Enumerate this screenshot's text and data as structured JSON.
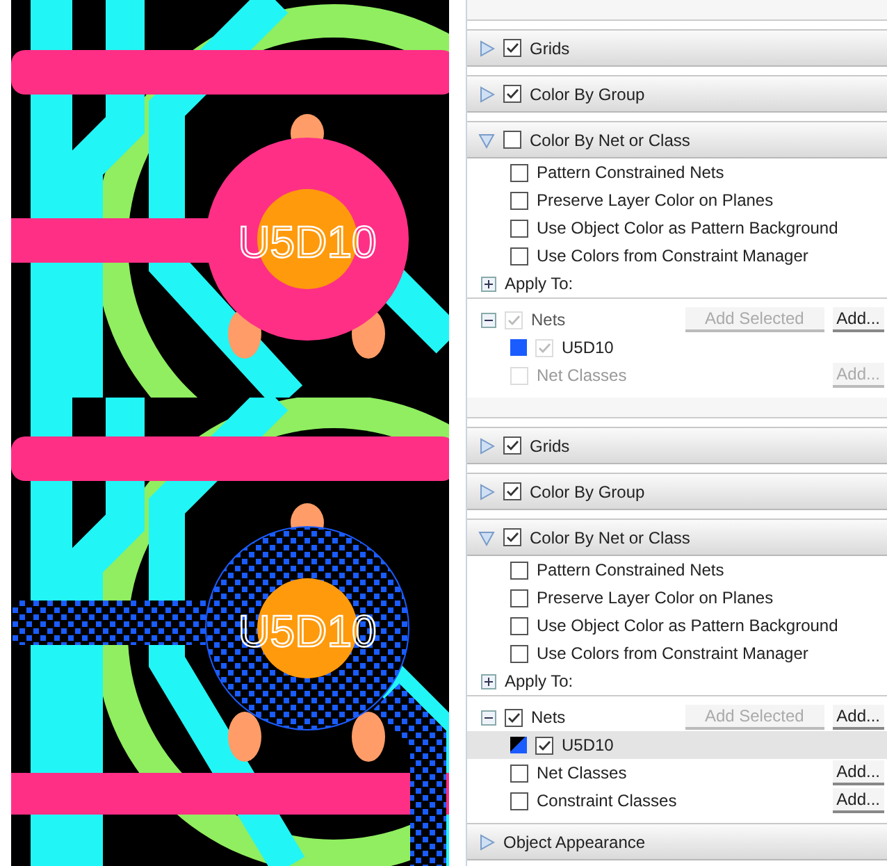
{
  "views": [
    {
      "canvas": {
        "label": "U5D10",
        "patterned": false
      },
      "panel": {
        "rows": [
          {
            "kind": "section",
            "title": "Grids",
            "checked": true,
            "expanded": false
          },
          {
            "kind": "section",
            "title": "Color By Group",
            "checked": true,
            "expanded": false
          },
          {
            "kind": "section",
            "title": "Color By Net or Class",
            "checked": false,
            "expanded": true
          },
          {
            "kind": "option",
            "label": "Pattern Constrained Nets",
            "checked": false
          },
          {
            "kind": "option",
            "label": "Preserve Layer Color on Planes",
            "checked": false
          },
          {
            "kind": "option",
            "label": "Use Object Color as Pattern Background",
            "checked": false
          },
          {
            "kind": "option",
            "label": "Use Colors from Constraint Manager",
            "checked": false
          },
          {
            "kind": "group",
            "label": "Apply To:",
            "expanded": false
          },
          {
            "kind": "target",
            "label": "Nets",
            "checked": true,
            "disabled": true,
            "expanded": true,
            "buttons": [
              {
                "label": "Add Selected",
                "disabled": true
              },
              {
                "label": "Add...",
                "disabled": false
              }
            ]
          },
          {
            "kind": "item",
            "label": "U5D10",
            "color": "#1a5cff",
            "patterned": false,
            "checked": true,
            "disabled": true,
            "selected": false
          },
          {
            "kind": "target",
            "label": "Net Classes",
            "checked": false,
            "disabled": true,
            "buttons": [
              {
                "label": "Add...",
                "disabled": true
              }
            ]
          }
        ]
      }
    },
    {
      "canvas": {
        "label": "U5D10",
        "patterned": true
      },
      "panel": {
        "rows": [
          {
            "kind": "section",
            "title": "Grids",
            "checked": true,
            "expanded": false
          },
          {
            "kind": "section",
            "title": "Color By Group",
            "checked": true,
            "expanded": false
          },
          {
            "kind": "section",
            "title": "Color By Net or Class",
            "checked": true,
            "expanded": true
          },
          {
            "kind": "option",
            "label": "Pattern Constrained Nets",
            "checked": false
          },
          {
            "kind": "option",
            "label": "Preserve Layer Color on Planes",
            "checked": false
          },
          {
            "kind": "option",
            "label": "Use Object Color as Pattern Background",
            "checked": false
          },
          {
            "kind": "option",
            "label": "Use Colors from Constraint Manager",
            "checked": false
          },
          {
            "kind": "group",
            "label": "Apply To:",
            "expanded": false
          },
          {
            "kind": "target",
            "label": "Nets",
            "checked": true,
            "disabled": false,
            "expanded": true,
            "buttons": [
              {
                "label": "Add Selected",
                "disabled": true
              },
              {
                "label": "Add...",
                "disabled": false
              }
            ]
          },
          {
            "kind": "item",
            "label": "U5D10",
            "color": "#1a5cff",
            "patterned": true,
            "checked": true,
            "disabled": false,
            "selected": true
          },
          {
            "kind": "target",
            "label": "Net Classes",
            "checked": false,
            "disabled": false,
            "buttons": [
              {
                "label": "Add...",
                "disabled": false
              }
            ]
          },
          {
            "kind": "target",
            "label": "Constraint Classes",
            "checked": false,
            "disabled": false,
            "buttons": [
              {
                "label": "Add...",
                "disabled": false
              }
            ]
          },
          {
            "kind": "section",
            "title": "Object Appearance",
            "expanded": false
          }
        ]
      }
    }
  ]
}
